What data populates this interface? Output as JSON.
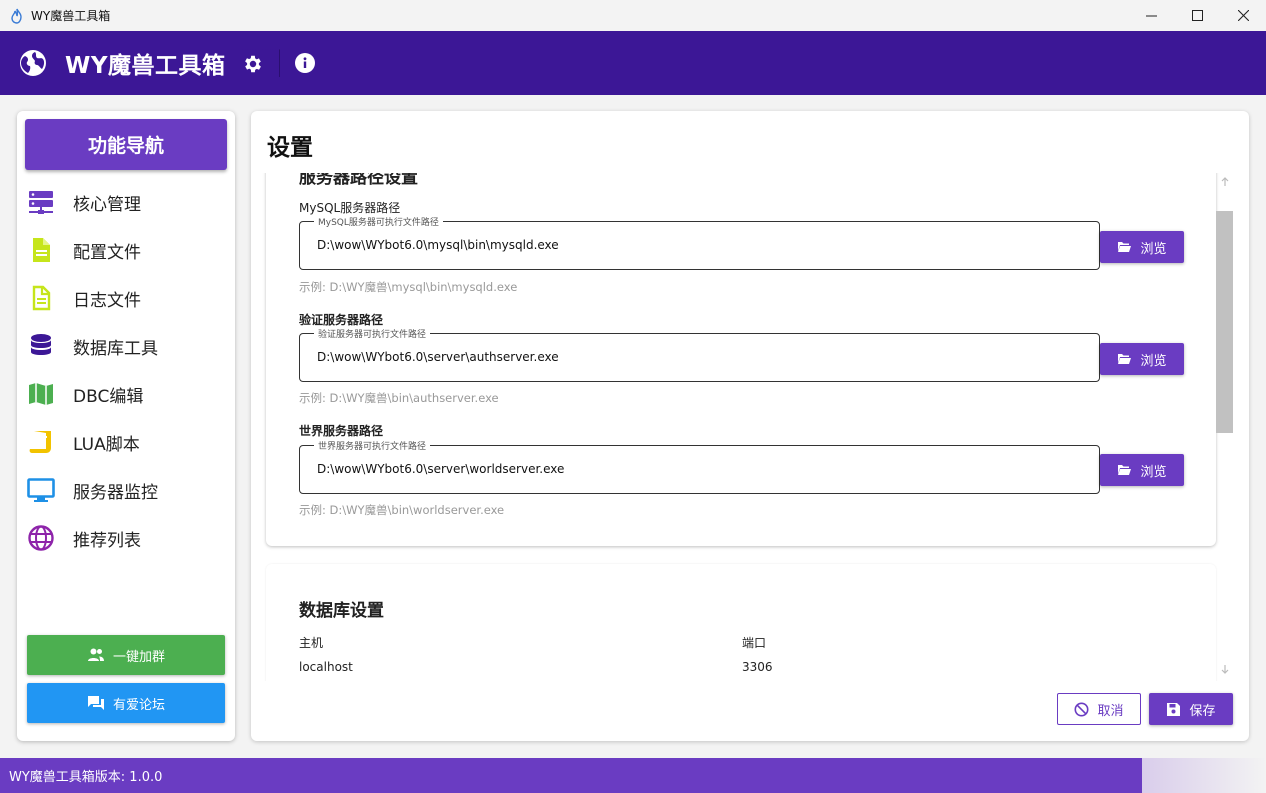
{
  "window": {
    "title": "WY魔兽工具箱"
  },
  "header": {
    "app_name": "WY魔兽工具箱"
  },
  "sidebar": {
    "nav_title": "功能导航",
    "items": [
      {
        "label": "核心管理",
        "icon": "server-icon",
        "color": "#6a3cc2"
      },
      {
        "label": "配置文件",
        "icon": "file-icon",
        "color": "#c6e51b"
      },
      {
        "label": "日志文件",
        "icon": "file-outline-icon",
        "color": "#c6e51b"
      },
      {
        "label": "数据库工具",
        "icon": "database-icon",
        "color": "#3c1796"
      },
      {
        "label": "DBC编辑",
        "icon": "map-icon",
        "color": "#4caf50"
      },
      {
        "label": "LUA脚本",
        "icon": "script-icon",
        "color": "#f2c300"
      },
      {
        "label": "服务器监控",
        "icon": "monitor-icon",
        "color": "#1e90e6"
      },
      {
        "label": "推荐列表",
        "icon": "globe-icon",
        "color": "#8e24aa"
      }
    ],
    "join_group_label": "一键加群",
    "forum_label": "有爱论坛"
  },
  "main": {
    "title": "设置",
    "server_section_title": "服务器路径设置",
    "fields": [
      {
        "label": "MySQL服务器路径",
        "legend": "MySQL服务器可执行文件路径",
        "value": "D:\\wow\\WYbot6.0\\mysql\\bin\\mysqld.exe",
        "hint": "示例: D:\\WY魔兽\\mysql\\bin\\mysqld.exe",
        "browse_label": "浏览"
      },
      {
        "label": "验证服务器路径",
        "legend": "验证服务器可执行文件路径",
        "value": "D:\\wow\\WYbot6.0\\server\\authserver.exe",
        "hint": "示例: D:\\WY魔兽\\bin\\authserver.exe",
        "browse_label": "浏览"
      },
      {
        "label": "世界服务器路径",
        "legend": "世界服务器可执行文件路径",
        "value": "D:\\wow\\WYbot6.0\\server\\worldserver.exe",
        "hint": "示例: D:\\WY魔兽\\bin\\worldserver.exe",
        "browse_label": "浏览"
      }
    ],
    "db_section": {
      "title": "数据库设置",
      "host_label": "主机",
      "host_value": "localhost",
      "port_label": "端口",
      "port_value": "3306"
    },
    "cancel_label": "取消",
    "save_label": "保存"
  },
  "status": {
    "version_text": "WY魔兽工具箱版本: 1.0.0"
  },
  "colors": {
    "header": "#3c1796",
    "accent": "#6a3cc2",
    "green": "#4caf50",
    "blue": "#2196f3"
  }
}
